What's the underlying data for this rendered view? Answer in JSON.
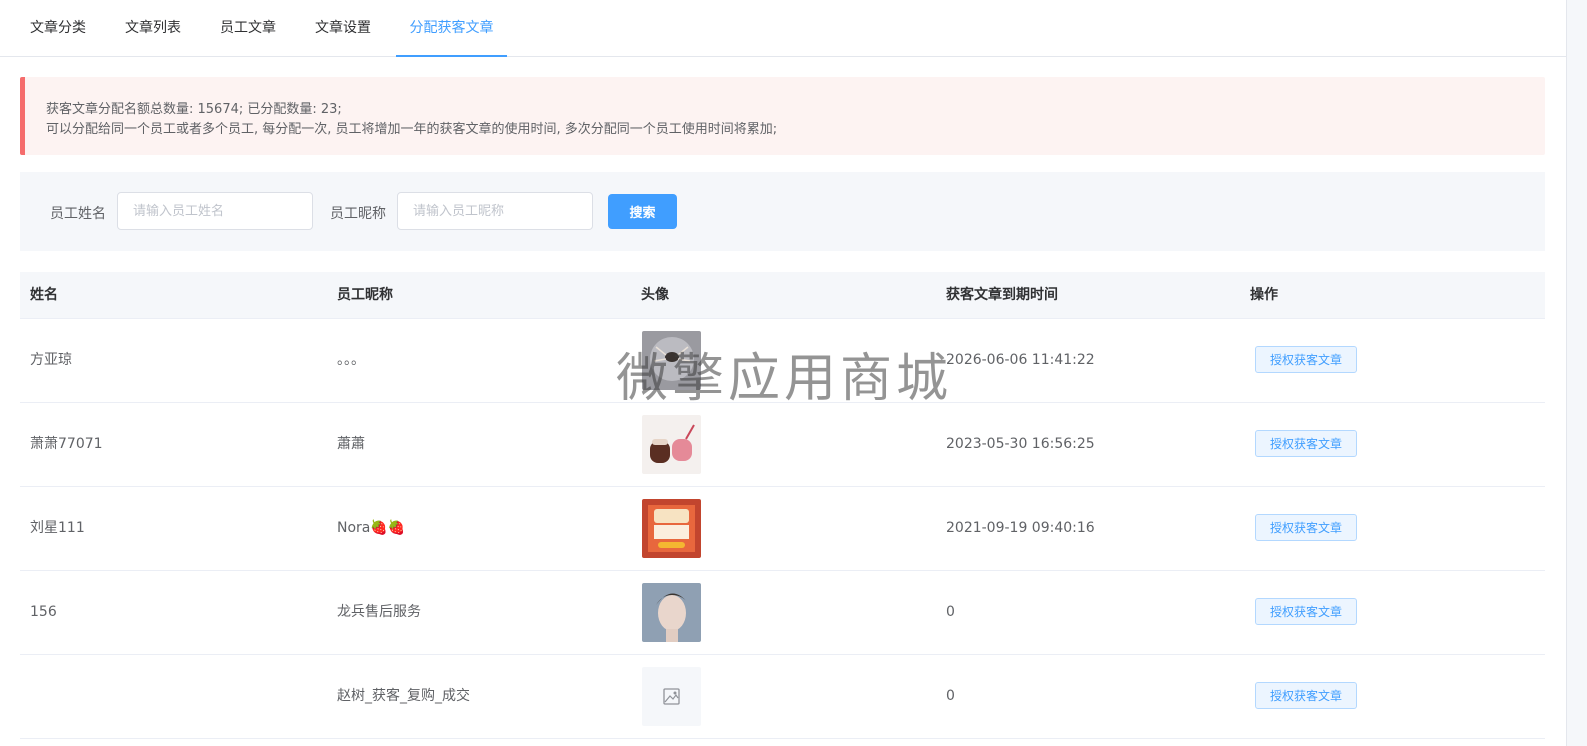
{
  "tabs": [
    "文章分类",
    "文章列表",
    "员工文章",
    "文章设置",
    "分配获客文章"
  ],
  "active_tab": "分配获客文章",
  "alert": {
    "line1": "获客文章分配名额总数量: 15674; 已分配数量: 23;",
    "line2": "可以分配给同一个员工或者多个员工, 每分配一次, 员工将增加一年的获客文章的使用时间, 多次分配同一个员工使用时间将累加;"
  },
  "search": {
    "name_label": "员工姓名",
    "name_placeholder": "请输入员工姓名",
    "nick_label": "员工昵称",
    "nick_placeholder": "请输入员工昵称",
    "button": "搜索"
  },
  "table": {
    "headers": [
      "姓名",
      "员工昵称",
      "头像",
      "获客文章到期时间",
      "操作"
    ],
    "rows": [
      {
        "name": "方亚琼",
        "nickname": "。。。",
        "avatar": "spider-photo",
        "expire": "2026-06-06 11:41:22",
        "action": "授权获客文章"
      },
      {
        "name": "萧萧77071",
        "nickname": "蕭蕭",
        "avatar": "cups-photo",
        "expire": "2023-05-30 16:56:25",
        "action": "授权获客文章"
      },
      {
        "name": "刘星111",
        "nickname": "Nora🍓🍓",
        "avatar": "poster-photo",
        "expire": "2021-09-19 09:40:16",
        "action": "授权获客文章"
      },
      {
        "name": "156",
        "nickname": "龙兵售后服务",
        "avatar": "portrait-photo",
        "expire": "0",
        "action": "授权获客文章"
      },
      {
        "name": "",
        "nickname": "赵树_获客_复购_成交",
        "avatar": "placeholder-image-icon",
        "expire": "0",
        "action": "授权获客文章"
      }
    ]
  },
  "watermark": "微擎应用商城",
  "colors": {
    "accent": "#409eff",
    "alert_border": "#f56c6c",
    "alert_bg": "#fdf3f2"
  }
}
